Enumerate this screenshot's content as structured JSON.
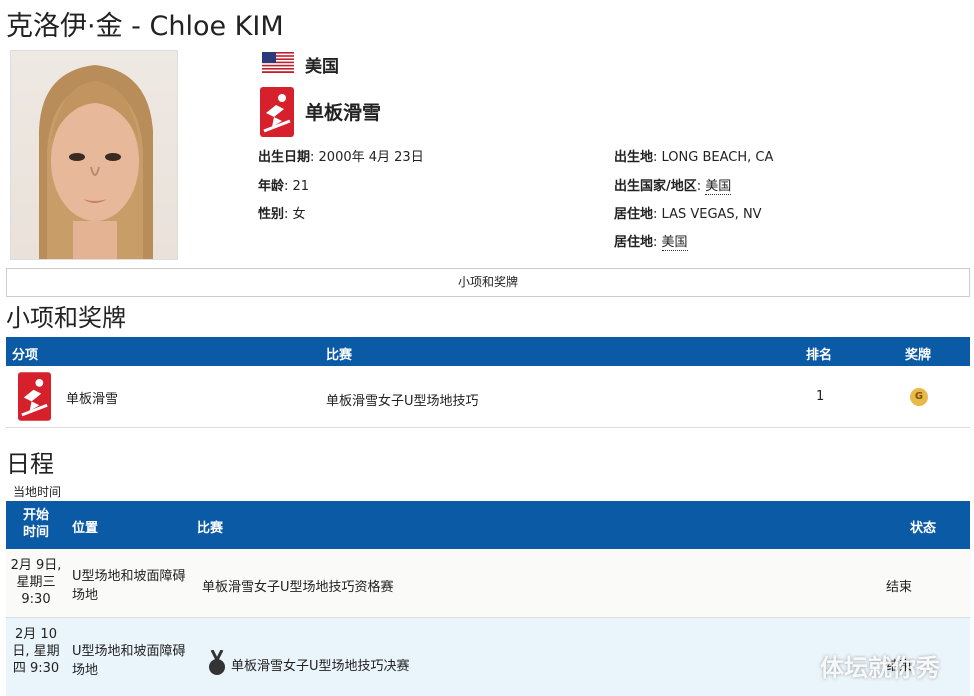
{
  "page": {
    "title": "克洛伊·金 - Chloe KIM"
  },
  "profile": {
    "country": "美国",
    "sport": "单板滑雪",
    "left_fields": [
      {
        "label": "出生日期",
        "value": "2000年 4月 23日"
      },
      {
        "label": "年龄",
        "value": "21"
      },
      {
        "label": "性别",
        "value": "女"
      }
    ],
    "right_fields": [
      {
        "label": "出生地",
        "value": "LONG BEACH, CA"
      },
      {
        "label": "出生国家/地区",
        "value": "美国"
      },
      {
        "label": "居住地",
        "value": "LAS VEGAS, NV"
      },
      {
        "label": "居住地",
        "value": "美国"
      }
    ]
  },
  "tab": {
    "label": "小项和奖牌"
  },
  "events_section": {
    "heading": "小项和奖牌",
    "columns": [
      "分项",
      "比赛",
      "排名",
      "奖牌"
    ],
    "rows": [
      {
        "discipline": "单板滑雪",
        "event": "单板滑雪女子U型场地技巧",
        "rank": "1",
        "medal": "G"
      }
    ]
  },
  "schedule_section": {
    "heading": "日程",
    "timezone_note": "当地时间",
    "columns": [
      "开始时间",
      "位置",
      "比赛",
      "状态"
    ],
    "rows": [
      {
        "time": "2月 9日, 星期三 9:30",
        "venue": "U型场地和坡面障碍场地",
        "event": "单板滑雪女子U型场地技巧资格赛",
        "status": "结束"
      },
      {
        "time": "2月 10日, 星期四 9:30",
        "venue": "U型场地和坡面障碍场地",
        "event": "单板滑雪女子U型场地技巧决赛",
        "status": "结束"
      }
    ]
  },
  "watermark": {
    "text": "体坛就你秀"
  },
  "colors": {
    "table_header": "#0a5aa6",
    "row_alt": "#eaf4fb",
    "sport_red": "#d6202b",
    "gold_medal": "#e8b84a"
  }
}
